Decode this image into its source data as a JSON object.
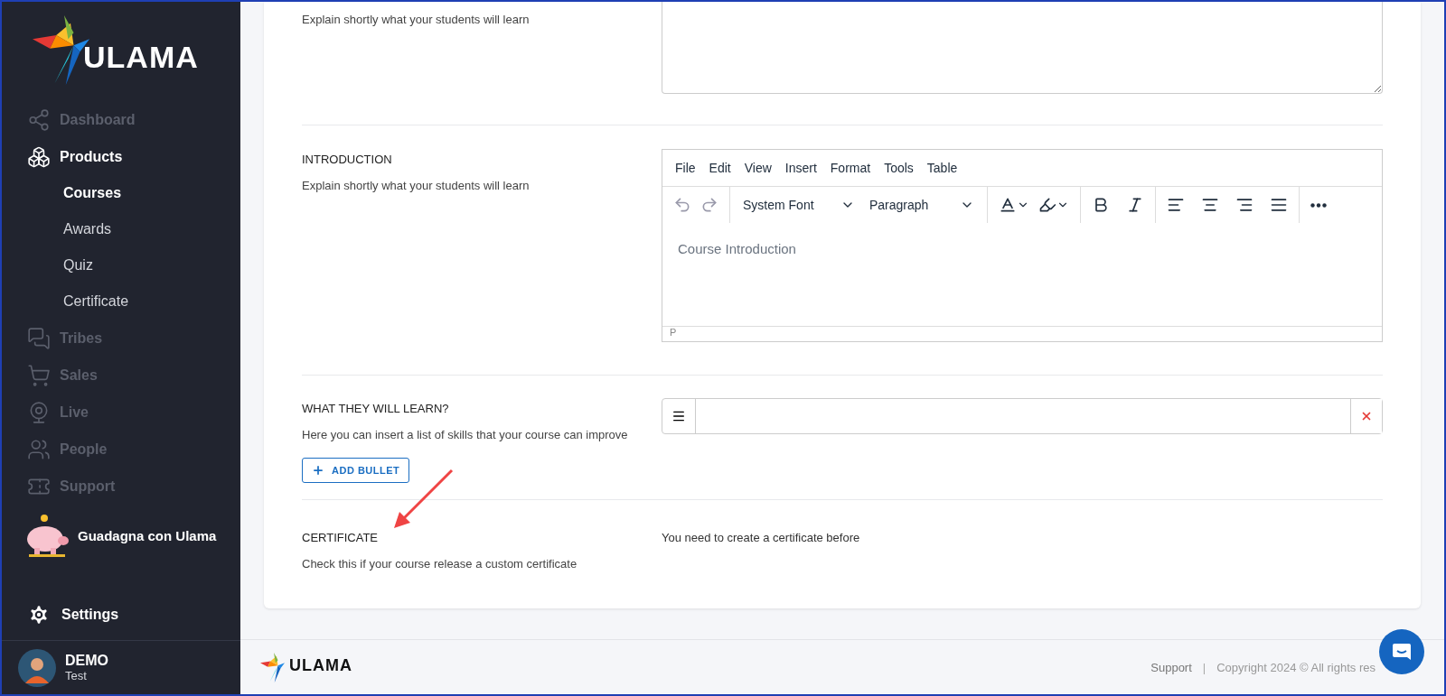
{
  "sidebar": {
    "logo_text": "ULAMA",
    "nav": [
      {
        "label": "Dashboard",
        "disabled": true
      },
      {
        "label": "Products",
        "disabled": false,
        "children": [
          {
            "label": "Courses",
            "selected": true
          },
          {
            "label": "Awards",
            "selected": false
          },
          {
            "label": "Quiz",
            "selected": false
          },
          {
            "label": "Certificate",
            "selected": false
          }
        ]
      },
      {
        "label": "Tribes",
        "disabled": true
      },
      {
        "label": "Sales",
        "disabled": true
      },
      {
        "label": "Live",
        "disabled": true
      },
      {
        "label": "People",
        "disabled": true
      },
      {
        "label": "Support",
        "disabled": true
      }
    ],
    "promo": "Guadagna con Ulama",
    "settings": "Settings",
    "user": {
      "name": "DEMO",
      "role": "Test"
    }
  },
  "form": {
    "sections": [
      {
        "kind": "textarea",
        "description": "Explain shortly what your students will learn"
      },
      {
        "kind": "editor",
        "title": "INTRODUCTION",
        "description": "Explain shortly what your students will learn",
        "editor": {
          "menu": [
            "File",
            "Edit",
            "View",
            "Insert",
            "Format",
            "Tools",
            "Table"
          ],
          "font": "System Font",
          "block": "Paragraph",
          "placeholder": "Course Introduction",
          "path": "P"
        }
      },
      {
        "kind": "bullets",
        "title": "WHAT THEY WILL LEARN?",
        "description": "Here you can insert a list of skills that your course can improve",
        "button": "ADD BULLET"
      },
      {
        "kind": "notice",
        "title": "CERTIFICATE",
        "description": "Check this if your course release a custom certificate",
        "notice": "You need to create a certificate before"
      }
    ]
  },
  "footer": {
    "logo_text": "ULAMA",
    "link": "Support",
    "separator": "|",
    "copyright": "Copyright 2024 © All rights res"
  }
}
